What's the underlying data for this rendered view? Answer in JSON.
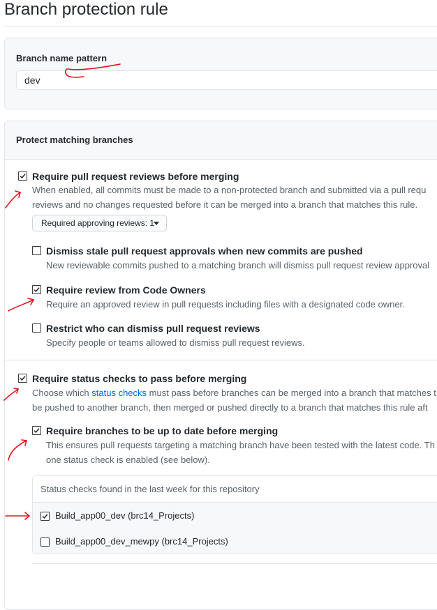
{
  "page": {
    "title": "Branch protection rule"
  },
  "name_pattern": {
    "label": "Branch name pattern",
    "value": "dev"
  },
  "protect": {
    "header": "Protect matching branches",
    "require_reviews": {
      "checked": true,
      "title": "Require pull request reviews before merging",
      "desc_line1": "When enabled, all commits must be made to a non-protected branch and submitted via a pull requ",
      "desc_line2": "reviews and no changes requested before it can be merged into a branch that matches this rule.",
      "approving_dropdown": "Required approving reviews: 1"
    },
    "dismiss_stale": {
      "checked": false,
      "title": "Dismiss stale pull request approvals when new commits are pushed",
      "desc": "New reviewable commits pushed to a matching branch will dismiss pull request review approval"
    },
    "code_owners": {
      "checked": true,
      "title": "Require review from Code Owners",
      "desc": "Require an approved review in pull requests including files with a designated code owner."
    },
    "restrict_dismiss": {
      "checked": false,
      "title": "Restrict who can dismiss pull request reviews",
      "desc": "Specify people or teams allowed to dismiss pull request reviews."
    },
    "status_checks": {
      "checked": true,
      "title": "Require status checks to pass before merging",
      "desc_prefix": "Choose which ",
      "desc_link": "status checks",
      "desc_suffix": " must pass before branches can be merged into a branch that matches t",
      "desc_line2": "be pushed to another branch, then merged or pushed directly to a branch that matches this rule aft"
    },
    "up_to_date": {
      "checked": true,
      "title": "Require branches to be up to date before merging",
      "desc_line1": "This ensures pull requests targeting a matching branch have been tested with the latest code. Th",
      "desc_line2": "one status check is enabled (see below)."
    },
    "checks_found": {
      "header": "Status checks found in the last week for this repository",
      "items": [
        {
          "label": "Build_app00_dev (brc14_Projects)",
          "checked": true
        },
        {
          "label": "Build_app00_dev_mewpy (brc14_Projects)",
          "checked": false
        }
      ]
    }
  },
  "colors": {
    "annotation": "#e0141e",
    "link": "#0366d6",
    "text": "#24292e",
    "muted": "#586069"
  },
  "icons": {
    "check": "check-icon",
    "caret": "caret-down-icon"
  }
}
